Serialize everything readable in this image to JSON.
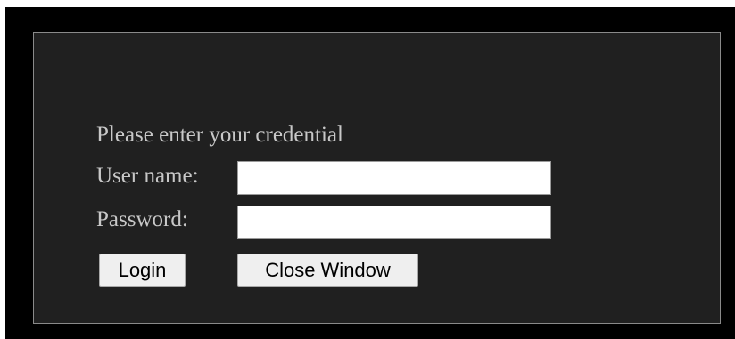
{
  "login_form": {
    "heading": "Please enter your credential",
    "username_label": "User name:",
    "username_value": "",
    "password_label": "Password:",
    "password_value": "",
    "login_button": "Login",
    "close_button": "Close Window"
  },
  "colors": {
    "background": "#000000",
    "panel": "#202020",
    "panel_border": "#8a8a8a",
    "text": "#c8c8c8",
    "button_bg": "#efefef"
  }
}
